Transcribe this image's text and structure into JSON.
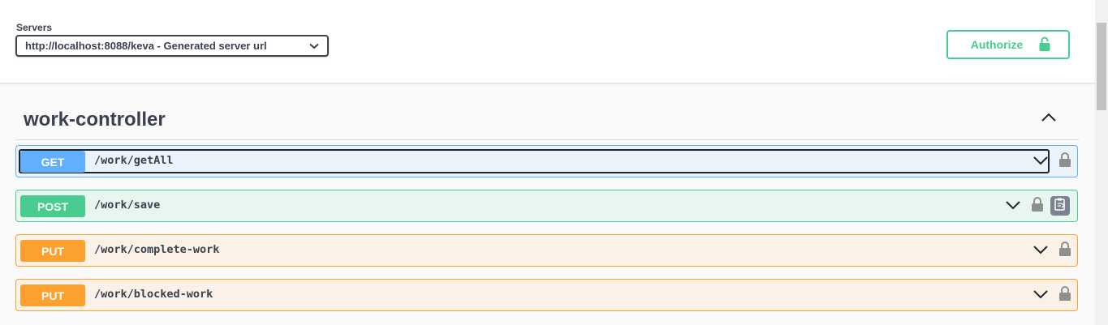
{
  "servers": {
    "label": "Servers",
    "selected": "http://localhost:8088/keva - Generated server url"
  },
  "authorize": {
    "label": "Authorize",
    "icon": "unlock-icon",
    "color": "#49cc90"
  },
  "tag": {
    "title": "work-controller",
    "toggle_icon": "chevron-up-icon"
  },
  "operations": [
    {
      "method": "GET",
      "path": "/work/getAll",
      "color": "#61affe"
    },
    {
      "method": "POST",
      "path": "/work/save",
      "color": "#49cc90"
    },
    {
      "method": "PUT",
      "path": "/work/complete-work",
      "color": "#fca130"
    },
    {
      "method": "PUT",
      "path": "/work/blocked-work",
      "color": "#fca130"
    }
  ]
}
